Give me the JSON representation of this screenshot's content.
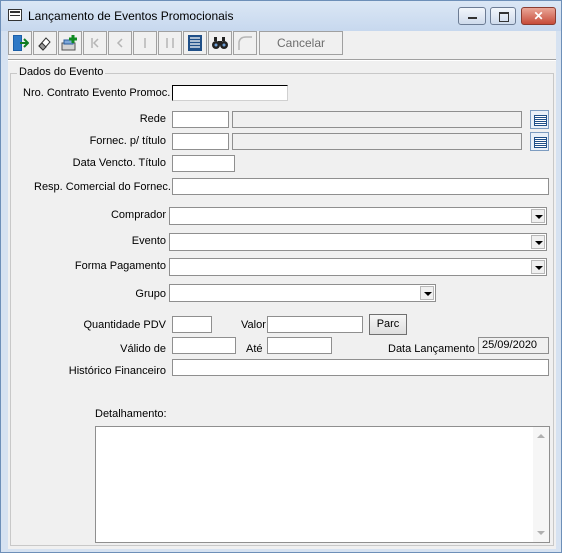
{
  "window": {
    "title": "Lançamento de Eventos Promocionais",
    "minimize_icon": "minimize-icon",
    "maximize_icon": "maximize-icon",
    "close_glyph": "✕"
  },
  "toolbar": {
    "buttons": [
      "exit-icon",
      "eraser-icon",
      "add-record-icon",
      "first-record-icon",
      "previous-record-icon",
      "next-record-icon",
      "last-record-icon",
      "list-icon",
      "binoculars-icon",
      "edit-icon"
    ],
    "cancel_label": "Cancelar"
  },
  "group": {
    "title": "Dados do Evento"
  },
  "form": {
    "nro_contrato_label": "Nro. Contrato Evento Promoc.",
    "rede_label": "Rede",
    "fornec_label": "Fornec. p/ título",
    "data_vencto_label": "Data Vencto. Título",
    "resp_comercial_label": "Resp. Comercial do Fornec.",
    "comprador_label": "Comprador",
    "evento_label": "Evento",
    "forma_pagamento_label": "Forma Pagamento",
    "grupo_label": "Grupo",
    "quantidade_pdv_label": "Quantidade PDV",
    "valor_label": "Valor",
    "parc_button": "Parc",
    "valido_de_label": "Válido de",
    "ate_label": "Até",
    "data_lancamento_label": "Data Lançamento",
    "data_lancamento_value": "25/09/2020",
    "historico_label": "Histórico Financeiro",
    "detalhamento_label": "Detalhamento:"
  }
}
